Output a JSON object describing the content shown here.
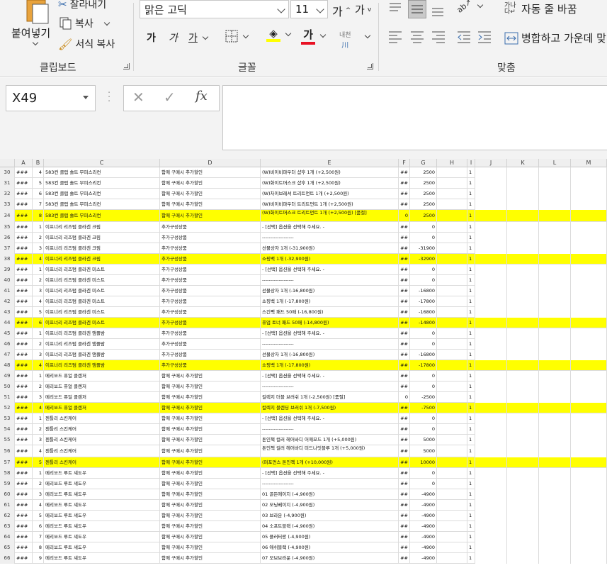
{
  "ribbon": {
    "clipboard": {
      "paste_label": "붙여넣기",
      "cut_label": "잘라내기",
      "copy_label": "복사",
      "format_painter_label": "서식 복사",
      "group_label": "클립보드"
    },
    "font": {
      "font_name": "맑은 고딕",
      "font_size": "11",
      "grow_label": "가",
      "shrink_label": "가",
      "bold_label": "가",
      "italic_label": "가",
      "underline_label": "가",
      "font_color_label": "가",
      "phonetic_label": "내천",
      "group_label": "글꼴",
      "fill_color": "#ffff00",
      "font_color": "#e81123"
    },
    "alignment": {
      "wrap_label": "자동 줄 바꿈",
      "merge_label": "병합하고 가운데 맞",
      "group_label": "맞춤"
    }
  },
  "formula_bar": {
    "name_box": "X49",
    "cancel_symbol": "✕",
    "enter_symbol": "✓",
    "fx_symbol": "fx",
    "formula": ""
  },
  "columns": [
    "A",
    "B",
    "C",
    "D",
    "E",
    "F",
    "G",
    "H",
    "I",
    "J",
    "K",
    "L",
    "M"
  ],
  "rows": [
    {
      "n": "30",
      "a": "###",
      "b": "4",
      "c": "583컨 클럽 솔트 무피스리컨",
      "d": "함께 구매시 추가할인",
      "e": "(W)비이비파우더 샵후 1개 (+2,500원)",
      "f": "##",
      "g": "2500",
      "i": "1",
      "hl": false
    },
    {
      "n": "31",
      "a": "###",
      "b": "5",
      "c": "583컨 클럽 솔트 무피스리컨",
      "d": "함께 구매시 추가할인",
      "e": "(W)화이트머스크 샵후 1개 (+2,500원)",
      "f": "##",
      "g": "2500",
      "i": "1",
      "hl": false
    },
    {
      "n": "32",
      "a": "###",
      "b": "6",
      "c": "583컨 클럽 솔트 무피스리컨",
      "d": "함께 구매시 추가할인",
      "e": "(W)차이브레셔 트리트먼트 1개 (+2,500원)",
      "f": "##",
      "g": "2500",
      "i": "1",
      "hl": false
    },
    {
      "n": "33",
      "a": "###",
      "b": "7",
      "c": "583컨 클럽 솔트 무피스리컨",
      "d": "함께 구매시 추가할인",
      "e": "(W)비이비파우더 트리트먼트 1개 (+2,500원)",
      "f": "##",
      "g": "2500",
      "i": "1",
      "hl": false
    },
    {
      "n": "34",
      "a": "###",
      "b": "8",
      "c": "583컨 클럽 솔트 무피스리컨",
      "d": "함께 구매시 추가할인",
      "e": "(W)화이트머스크 트리트먼트 1개 (+2,500원) [품절]",
      "f": "0",
      "g": "2500",
      "i": "1",
      "hl": true,
      "tall": true
    },
    {
      "n": "35",
      "a": "###",
      "b": "1",
      "c": "이프너리 리즈텀 클라겐 크림",
      "d": "추가구성상품",
      "e": "- [선택] 옵션을 선택해 주세요. -",
      "f": "##",
      "g": "0",
      "i": "1",
      "hl": false
    },
    {
      "n": "36",
      "a": "###",
      "b": "2",
      "c": "이프너리 리즈텀 클라겐 크림",
      "d": "추가구성상품",
      "e": "-------------------",
      "f": "##",
      "g": "0",
      "i": "1",
      "hl": false
    },
    {
      "n": "37",
      "a": "###",
      "b": "3",
      "c": "이프너리 리즈텀 클라겐 크림",
      "d": "추가구성상품",
      "e": "선물상자 1개 (-31,900원)",
      "f": "##",
      "g": "-31900",
      "i": "1",
      "hl": false
    },
    {
      "n": "38",
      "a": "###",
      "b": "4",
      "c": "이프너리 리즈텀 클라겐 크림",
      "d": "추가구성상품",
      "e": "쇼핑백 1개 (-32,900원)",
      "f": "##",
      "g": "-32900",
      "i": "1",
      "hl": true
    },
    {
      "n": "39",
      "a": "###",
      "b": "1",
      "c": "이프너리 리즈텀 클라겐 미스트",
      "d": "추가구성상품",
      "e": "- [선택] 옵션을 선택해 주세요. -",
      "f": "##",
      "g": "0",
      "i": "1",
      "hl": false
    },
    {
      "n": "40",
      "a": "###",
      "b": "2",
      "c": "이프너리 리즈텀 클라겐 미스트",
      "d": "추가구성상품",
      "e": "-------------------",
      "f": "##",
      "g": "0",
      "i": "1",
      "hl": false
    },
    {
      "n": "41",
      "a": "###",
      "b": "3",
      "c": "이프너리 리즈텀 클라겐 미스트",
      "d": "추가구성상품",
      "e": "선물상자 1개 (-16,800원)",
      "f": "##",
      "g": "-16800",
      "i": "1",
      "hl": false
    },
    {
      "n": "42",
      "a": "###",
      "b": "4",
      "c": "이프너리 리즈텀 클라겐 미스트",
      "d": "추가구성상품",
      "e": "쇼핑백 1개 (-17,800원)",
      "f": "##",
      "g": "-17800",
      "i": "1",
      "hl": false
    },
    {
      "n": "43",
      "a": "###",
      "b": "5",
      "c": "이프너리 리즈텀 클라겐 미스트",
      "d": "추가구성상품",
      "e": "스킨팩 패드 50매 (-16,800원)",
      "f": "##",
      "g": "-16800",
      "i": "1",
      "hl": false
    },
    {
      "n": "44",
      "a": "###",
      "b": "6",
      "c": "이프너리 리즈텀 클라겐 미스트",
      "d": "추가구성상품",
      "e": "퓨업 토너 패드 50매 (-14,800원)",
      "f": "##",
      "g": "-14800",
      "i": "1",
      "hl": true
    },
    {
      "n": "45",
      "a": "###",
      "b": "1",
      "c": "이프너리 리즈텀 클라겐 앰플밤",
      "d": "추가구성상품",
      "e": "- [선택] 옵션을 선택해 주세요. -",
      "f": "##",
      "g": "0",
      "i": "1",
      "hl": false
    },
    {
      "n": "46",
      "a": "###",
      "b": "2",
      "c": "이프너리 리즈텀 클라겐 앰플밤",
      "d": "추가구성상품",
      "e": "-------------------",
      "f": "##",
      "g": "0",
      "i": "1",
      "hl": false
    },
    {
      "n": "47",
      "a": "###",
      "b": "3",
      "c": "이프너리 리즈텀 클라겐 앰플밤",
      "d": "추가구성상품",
      "e": "선물상자 1개 (-16,800원)",
      "f": "##",
      "g": "-16800",
      "i": "1",
      "hl": false
    },
    {
      "n": "48",
      "a": "###",
      "b": "4",
      "c": "이프너리 리즈텀 클라겐 앰플밤",
      "d": "추가구성상품",
      "e": "쇼핑백 1개 (-17,800원)",
      "f": "##",
      "g": "-17800",
      "i": "1",
      "hl": true
    },
    {
      "n": "49",
      "a": "###",
      "b": "1",
      "c": "메리쏘드 퓨얼 클렌저",
      "d": "함께 구매시 추가할인",
      "e": "- [선택] 옵션을 선택해 주세요. -",
      "f": "##",
      "g": "0",
      "i": "1",
      "hl": false
    },
    {
      "n": "50",
      "a": "###",
      "b": "2",
      "c": "메리쏘드 퓨얼 클렌저",
      "d": "함께 구매시 추가할인",
      "e": "-------------------",
      "f": "##",
      "g": "0",
      "i": "1",
      "hl": false
    },
    {
      "n": "51",
      "a": "###",
      "b": "3",
      "c": "메리쏘드 퓨얼 클렌저",
      "d": "함께 구매시 추가할인",
      "e": "컬렉지 더블 브러쉬 1개 (-2,500원) [품절]",
      "f": "0",
      "g": "-2500",
      "i": "1",
      "hl": false
    },
    {
      "n": "52",
      "a": "###",
      "b": "4",
      "c": "메리쏘드 퓨얼 클렌저",
      "d": "함께 구매시 추가할인",
      "e": "컬렉지 블렌딩 브러쉬 1개 (-7,500원)",
      "f": "##",
      "g": "-7500",
      "i": "1",
      "hl": true
    },
    {
      "n": "53",
      "a": "###",
      "b": "1",
      "c": "젠틀리 스킨케어",
      "d": "함께 구매시 추가할인",
      "e": "- [선택] 옵션을 선택해 주세요. -",
      "f": "##",
      "g": "0",
      "i": "1",
      "hl": false
    },
    {
      "n": "54",
      "a": "###",
      "b": "2",
      "c": "젠틀리 스킨케어",
      "d": "함께 구매시 추가할인",
      "e": "-------------------",
      "f": "##",
      "g": "0",
      "i": "1",
      "hl": false
    },
    {
      "n": "55",
      "a": "###",
      "b": "3",
      "c": "젠틀리 스킨케어",
      "d": "함께 구매시 추가할인",
      "e": "톤인첵 컬러 헤어바디 어깨모드 1개 (+5,000원)",
      "f": "##",
      "g": "5000",
      "i": "1",
      "hl": false
    },
    {
      "n": "56",
      "a": "###",
      "b": "4",
      "c": "젠틀리 스킨케어",
      "d": "함께 구매시 추가할인",
      "e": "톤인첵 컬러 헤어바디 미드나잇블루 1개 (+5,000원)",
      "f": "##",
      "g": "5000",
      "i": "1",
      "hl": false,
      "tall": true
    },
    {
      "n": "57",
      "a": "###",
      "b": "5",
      "c": "젠틀리 스킨케어",
      "d": "함께 구매시 추가할인",
      "e": "(퍼포먼스 톤인첵 1개 (+10,000원)",
      "f": "##",
      "g": "10000",
      "i": "1",
      "hl": true
    },
    {
      "n": "58",
      "a": "###",
      "b": "1",
      "c": "메리쏘드 루트 섀도우",
      "d": "함께 구매시 추가할인",
      "e": "- [선택] 옵션을 선택해 주세요. -",
      "f": "##",
      "g": "0",
      "i": "1",
      "hl": false
    },
    {
      "n": "59",
      "a": "###",
      "b": "2",
      "c": "메리쏘드 루트 섀도우",
      "d": "함께 구매시 추가할인",
      "e": "-------------------",
      "f": "##",
      "g": "0",
      "i": "1",
      "hl": false
    },
    {
      "n": "60",
      "a": "###",
      "b": "3",
      "c": "메리쏘드 루트 섀도우",
      "d": "함께 구매시 추가할인",
      "e": "01 골든에이지 (-4,900원)",
      "f": "##",
      "g": "-4900",
      "i": "1",
      "hl": false
    },
    {
      "n": "61",
      "a": "###",
      "b": "4",
      "c": "메리쏘드 루트 섀도우",
      "d": "함께 구매시 추가할인",
      "e": "02 모닝베이지 (-4,900원)",
      "f": "##",
      "g": "-4900",
      "i": "1",
      "hl": false
    },
    {
      "n": "62",
      "a": "###",
      "b": "5",
      "c": "메리쏘드 루트 섀도우",
      "d": "함께 구매시 추가할인",
      "e": "03 브라운 (-4,900원)",
      "f": "##",
      "g": "-4900",
      "i": "1",
      "hl": false
    },
    {
      "n": "63",
      "a": "###",
      "b": "6",
      "c": "메리쏘드 루트 섀도우",
      "d": "함께 구매시 추가할인",
      "e": "04 소프트블랙 (-4,900원)",
      "f": "##",
      "g": "-4900",
      "i": "1",
      "hl": false
    },
    {
      "n": "64",
      "a": "###",
      "b": "7",
      "c": "메리쏘드 루트 섀도우",
      "d": "함께 구매시 추가할인",
      "e": "05 플러터랑 (-4,900원)",
      "f": "##",
      "g": "-4900",
      "i": "1",
      "hl": false
    },
    {
      "n": "65",
      "a": "###",
      "b": "8",
      "c": "메리쏘드 루트 섀도우",
      "d": "함께 구매시 추가할인",
      "e": "06 애쉬블랙 (-4,900원)",
      "f": "##",
      "g": "-4900",
      "i": "1",
      "hl": false
    },
    {
      "n": "66",
      "a": "###",
      "b": "9",
      "c": "메리쏘드 루트 섀도우",
      "d": "함께 구매시 추가할인",
      "e": "07 모브브라운 (-4,900원)",
      "f": "##",
      "g": "-4900",
      "i": "1",
      "hl": false
    }
  ]
}
